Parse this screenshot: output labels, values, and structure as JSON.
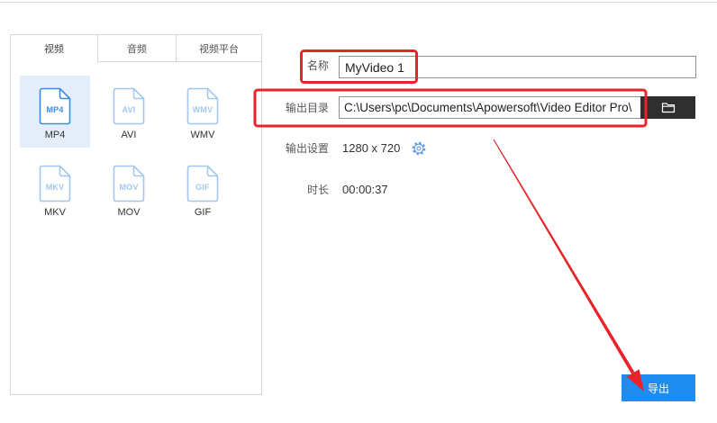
{
  "colors": {
    "accent": "#1e8cf0",
    "annotation": "#e8242a",
    "folder_button": "#2f2f2f",
    "selected_tile": "#e3eefa",
    "icon": "#a3c8ee",
    "icon_selected": "#3b8de4"
  },
  "format_panel": {
    "tabs": [
      {
        "label": "视频",
        "active": true
      },
      {
        "label": "音频",
        "active": false
      },
      {
        "label": "视频平台",
        "active": false
      }
    ],
    "formats": [
      {
        "icon": "mp4-file-icon",
        "label": "MP4",
        "selected": true
      },
      {
        "icon": "avi-file-icon",
        "label": "AVI",
        "selected": false
      },
      {
        "icon": "wmv-file-icon",
        "label": "WMV",
        "selected": false
      },
      {
        "icon": "mkv-file-icon",
        "label": "MKV",
        "selected": false
      },
      {
        "icon": "mov-file-icon",
        "label": "MOV",
        "selected": false
      },
      {
        "icon": "gif-file-icon",
        "label": "GIF",
        "selected": false
      }
    ]
  },
  "settings": {
    "name": {
      "label": "名称",
      "value": "MyVideo 1"
    },
    "output_dir": {
      "label": "输出目录",
      "value": "C:\\Users\\pc\\Documents\\Apowersoft\\Video Editor Pro\\",
      "button_icon": "folder-icon"
    },
    "output_settings": {
      "label": "输出设置",
      "value": "1280 x 720",
      "button_icon": "gear-icon"
    },
    "duration": {
      "label": "时长",
      "value": "00:00:37"
    }
  },
  "export_button": {
    "label": "导出"
  }
}
